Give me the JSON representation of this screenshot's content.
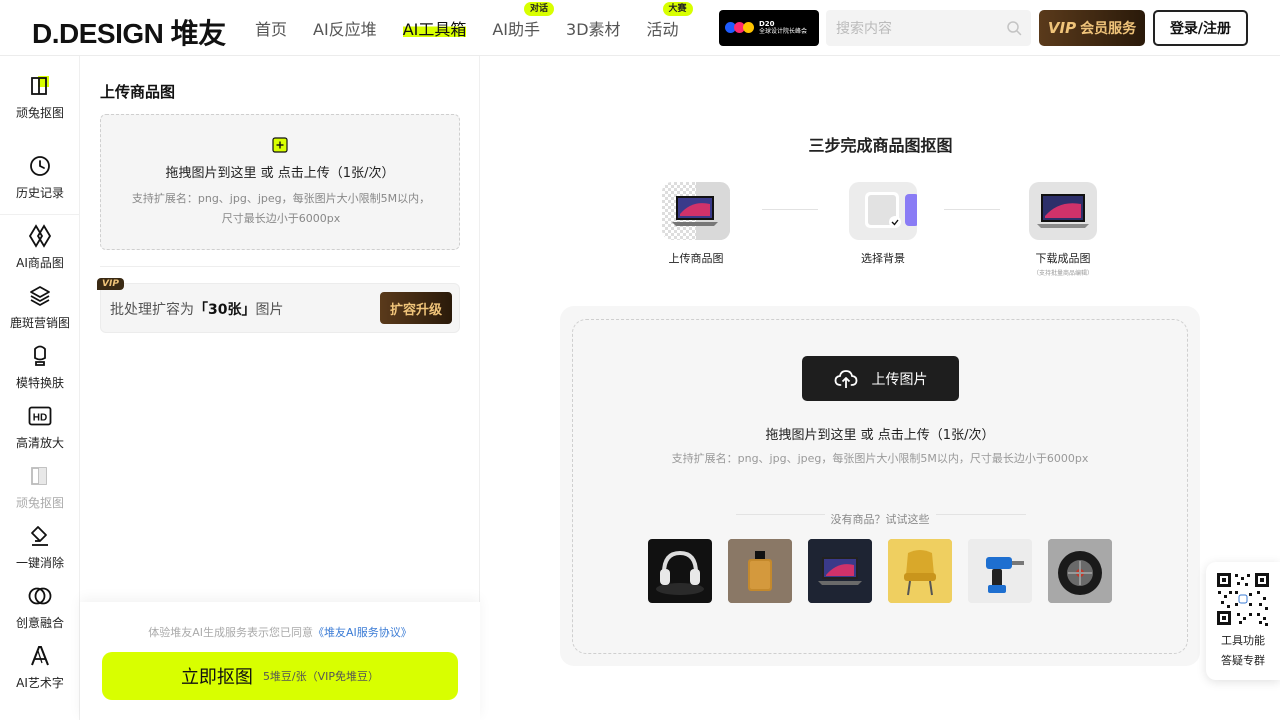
{
  "header": {
    "logo": "D.DESIGN 堆友",
    "nav": [
      {
        "label": "首页",
        "badge": ""
      },
      {
        "label": "AI反应堆",
        "badge": ""
      },
      {
        "label": "AI工具箱",
        "badge": ""
      },
      {
        "label": "AI助手",
        "badge": "对话"
      },
      {
        "label": "3D素材",
        "badge": ""
      },
      {
        "label": "活动",
        "badge": "大赛"
      }
    ],
    "banner": {
      "line1": "D20",
      "line2": "全球设计院长峰会"
    },
    "search_placeholder": "搜索内容",
    "vip_mark": "VIP",
    "vip_label": "会员服务",
    "login_label": "登录/注册"
  },
  "rail": {
    "items": [
      "顽兔抠图",
      "历史记录",
      "AI商品图",
      "鹿斑营销图",
      "模特换肤",
      "高清放大",
      "顽兔抠图",
      "一键消除",
      "创意融合",
      "AI艺术字"
    ]
  },
  "panel": {
    "title": "上传商品图",
    "drop_main": "拖拽图片到这里 或 点击上传（1张/次）",
    "drop_sub": "支持扩展名：png、jpg、jpeg，每张图片大小限制5M以内，尺寸最长边小于6000px",
    "batch_vip": "VIP",
    "batch_prefix": "批处理扩容为",
    "batch_count": "「30张」",
    "batch_suffix": "图片",
    "upgrade_label": "扩容升级",
    "agree_prefix": "体验堆友AI生成服务表示您已同意",
    "agree_link": "《堆友AI服务协议》",
    "cta_label": "立即抠图",
    "cta_cost": "5堆豆/张（VIP免堆豆）"
  },
  "main": {
    "steps_title": "三步完成商品图抠图",
    "steps": [
      {
        "label": "上传商品图",
        "note": ""
      },
      {
        "label": "选择背景",
        "note": ""
      },
      {
        "label": "下载成品图",
        "note": "（支持批量商品编辑）"
      }
    ],
    "upload_label": "上传图片",
    "drop_main": "拖拽图片到这里 或 点击上传（1张/次）",
    "drop_sub": "支持扩展名：png、jpg、jpeg，每张图片大小限制5M以内，尺寸最长边小于6000px",
    "try_label": "没有商品？试试这些"
  },
  "qr": {
    "line1": "工具功能",
    "line2": "答疑专群"
  },
  "colors": {
    "accent": "#d8ff00",
    "vip_dark": "#3a2a14",
    "vip_gold": "#f0c47a",
    "link": "#3a7bd5"
  }
}
